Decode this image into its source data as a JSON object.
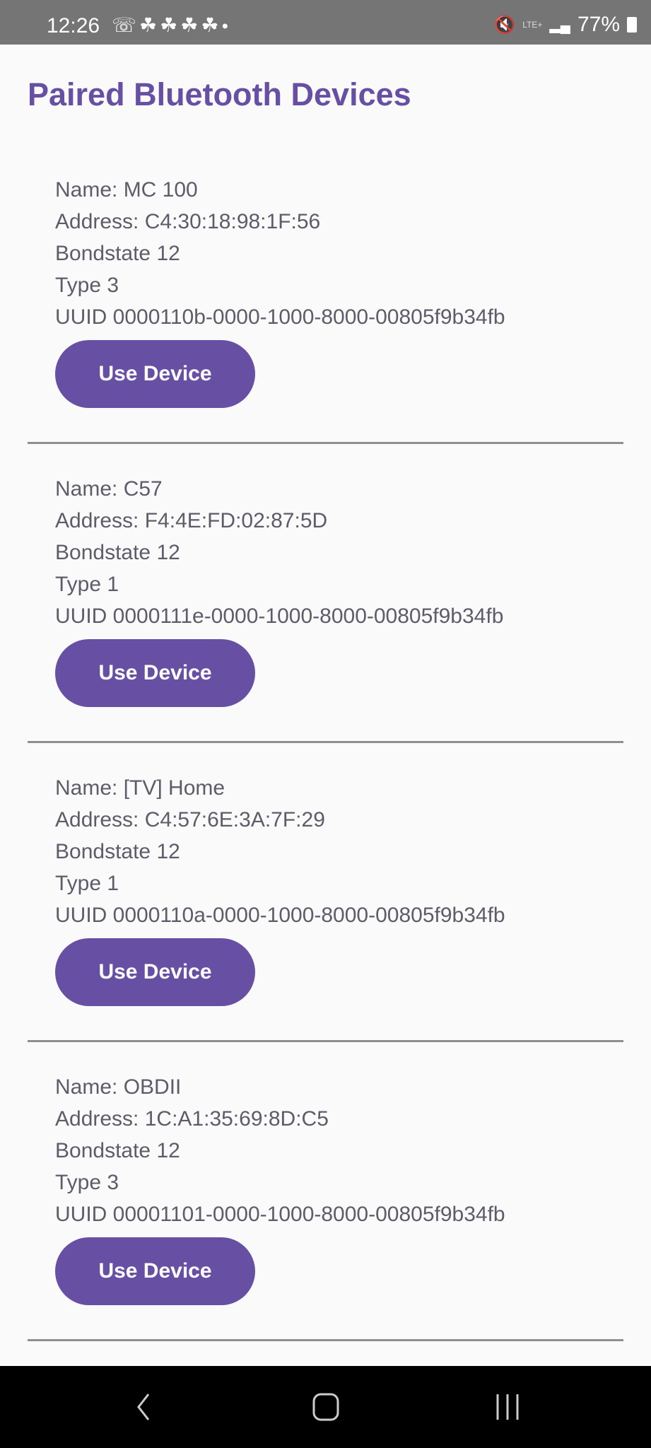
{
  "status_bar": {
    "time": "12:26",
    "notification_icons": [
      "whatsapp-icon",
      "snapchat-icon",
      "snapchat-icon",
      "snapchat-icon",
      "snapchat-icon",
      "dot-icon"
    ],
    "network": "LTE+",
    "battery": "77%"
  },
  "page": {
    "title": "Paired Bluetooth Devices"
  },
  "colors": {
    "accent": "#6750a4",
    "text": "#5f5b69",
    "background": "#fafafa"
  },
  "devices": [
    {
      "name": "Name: MC 100",
      "address": "Address: C4:30:18:98:1F:56",
      "bondstate": "Bondstate 12",
      "type": "Type 3",
      "uuid": "UUID 0000110b-0000-1000-8000-00805f9b34fb",
      "button": "Use Device"
    },
    {
      "name": "Name: C57",
      "address": "Address: F4:4E:FD:02:87:5D",
      "bondstate": "Bondstate 12",
      "type": "Type 1",
      "uuid": "UUID 0000111e-0000-1000-8000-00805f9b34fb",
      "button": "Use Device"
    },
    {
      "name": "Name: [TV] Home",
      "address": "Address: C4:57:6E:3A:7F:29",
      "bondstate": "Bondstate 12",
      "type": "Type 1",
      "uuid": "UUID 0000110a-0000-1000-8000-00805f9b34fb",
      "button": "Use Device"
    },
    {
      "name": "Name: OBDII",
      "address": "Address: 1C:A1:35:69:8D:C5",
      "bondstate": "Bondstate 12",
      "type": "Type 3",
      "uuid": "UUID 00001101-0000-1000-8000-00805f9b34fb",
      "button": "Use Device"
    }
  ]
}
